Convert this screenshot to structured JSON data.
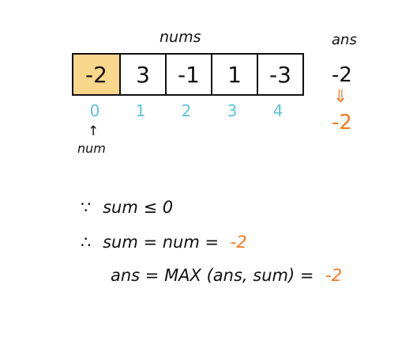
{
  "array": {
    "label": "nums",
    "cells": [
      "-2",
      "3",
      "-1",
      "1",
      "-3"
    ],
    "highlight_index": 0,
    "indices": [
      "0",
      "1",
      "2",
      "3",
      "4"
    ]
  },
  "pointer": {
    "arrow": "↑",
    "label": "num"
  },
  "ans": {
    "label": "ans",
    "before": "-2",
    "arrow": "⇓",
    "after": "-2"
  },
  "steps": [
    {
      "symbol": "∵",
      "text": "sum ≤ 0",
      "result": ""
    },
    {
      "symbol": "∴",
      "text": "sum = num =",
      "result": "-2"
    },
    {
      "symbol": "",
      "text": "ans = MAX (ans, sum) =",
      "result": "-2"
    }
  ],
  "colors": {
    "highlight": "#f8d68c",
    "index": "#5ec4da",
    "accent": "#f47b20"
  }
}
